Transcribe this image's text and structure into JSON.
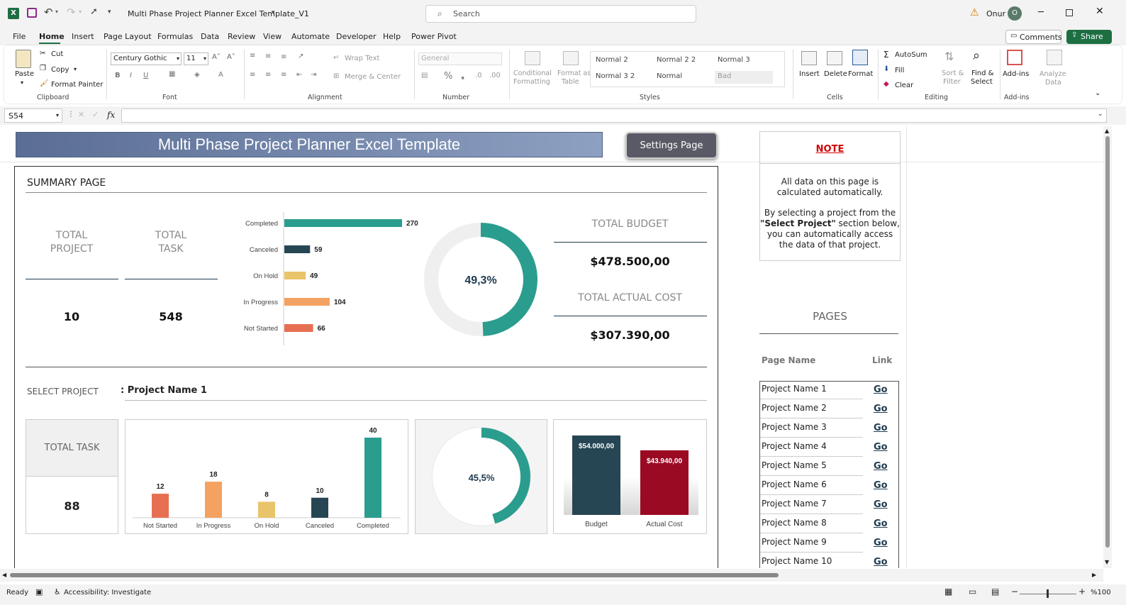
{
  "titlebar": {
    "doc_title": "Multi Phase Project Planner Excel Template_V1",
    "search_placeholder": "Search",
    "user_name": "Onur",
    "user_initial": "O"
  },
  "menu": [
    "File",
    "Home",
    "Insert",
    "Page Layout",
    "Formulas",
    "Data",
    "Review",
    "View",
    "Automate",
    "Developer",
    "Help",
    "Power Pivot"
  ],
  "topbuttons": {
    "comments": "Comments",
    "share": "Share"
  },
  "ribbon": {
    "clipboard": {
      "paste": "Paste",
      "cut": "Cut",
      "copy": "Copy",
      "format_painter": "Format Painter",
      "label": "Clipboard"
    },
    "font": {
      "name": "Century Gothic",
      "size": "11",
      "label": "Font"
    },
    "alignment": {
      "wrap": "Wrap Text",
      "merge": "Merge & Center",
      "label": "Alignment"
    },
    "number": {
      "format": "General",
      "label": "Number"
    },
    "styles": {
      "cond": "Conditional",
      "cond2": "Formatting",
      "fmt_table": "Format as",
      "fmt_table2": "Table",
      "label": "Styles",
      "cells": [
        "Normal 2",
        "Normal 2 2",
        "Normal 3",
        "Normal 3 2",
        "Normal",
        "Bad"
      ]
    },
    "cells": {
      "insert": "Insert",
      "delete": "Delete",
      "format": "Format",
      "label": "Cells"
    },
    "editing": {
      "autosum": "AutoSum",
      "fill": "Fill",
      "clear": "Clear",
      "sort": "Sort &",
      "sort2": "Filter",
      "find": "Find &",
      "find2": "Select",
      "label": "Editing"
    },
    "addins": {
      "addins": "Add-ins",
      "analyze": "Analyze",
      "analyze2": "Data",
      "label": "Add-ins"
    }
  },
  "formula": {
    "namebox": "S54",
    "fx": "fx"
  },
  "dashboard": {
    "title": "Multi Phase Project Planner Excel Template",
    "settings": "Settings Page",
    "summary": "SUMMARY PAGE",
    "total_project_label": [
      "TOTAL",
      "PROJECT"
    ],
    "total_task_label": [
      "TOTAL",
      "TASK"
    ],
    "total_project_value": "10",
    "total_task_value": "548",
    "total_budget_label": "TOTAL BUDGET",
    "total_budget_value": "$478.500,00",
    "total_actual_label": "TOTAL ACTUAL COST",
    "total_actual_value": "$307.390,00",
    "select_project_label": "SELECT PROJECT",
    "select_project_value": ": Project Name 1",
    "project_total_task_label": "TOTAL TASK",
    "project_total_task_value": "88"
  },
  "note": {
    "title": "NOTE",
    "line1": "All data on this page is",
    "line2": "calculated automatically.",
    "line3": "By selecting a project from the",
    "line4_bold": "\"Select Project\"",
    "line4_rest": " section below,",
    "line5": "you can automatically access",
    "line6": "the data of that project."
  },
  "pages": {
    "title": "PAGES",
    "col_name": "Page Name",
    "col_link": "Link",
    "link_text": "Go",
    "rows": [
      "Project Name 1",
      "Project Name 2",
      "Project Name 3",
      "Project Name 4",
      "Project Name 5",
      "Project Name 6",
      "Project Name 7",
      "Project Name 8",
      "Project Name 9",
      "Project Name 10"
    ]
  },
  "status": {
    "ready": "Ready",
    "accessibility": "Accessibility: Investigate",
    "zoom": "%100"
  },
  "colors": {
    "teal": "#2a9d8f",
    "navy": "#264653",
    "yellow": "#e9c46a",
    "orange": "#f4a261",
    "red": "#e76f51",
    "crimson": "#9b0a23"
  },
  "chart_data": [
    {
      "type": "bar",
      "orientation": "horizontal",
      "categories": [
        "Completed",
        "Canceled",
        "On Hold",
        "In Progress",
        "Not Started"
      ],
      "values": [
        270,
        59,
        49,
        104,
        66
      ],
      "colors": [
        "#2a9d8f",
        "#264653",
        "#e9c46a",
        "#f4a261",
        "#e76f51"
      ]
    },
    {
      "type": "pie",
      "variant": "donut",
      "values": [
        49.3,
        50.7
      ],
      "center_label": "49,3%"
    },
    {
      "type": "bar",
      "categories": [
        "Not Started",
        "In Progress",
        "On Hold",
        "Canceled",
        "Completed"
      ],
      "values": [
        12,
        18,
        8,
        10,
        40
      ],
      "colors": [
        "#e76f51",
        "#f4a261",
        "#e9c46a",
        "#264653",
        "#2a9d8f"
      ]
    },
    {
      "type": "pie",
      "variant": "donut",
      "values": [
        45.5,
        54.5
      ],
      "center_label": "45,5%"
    },
    {
      "type": "bar",
      "categories": [
        "Budget",
        "Actual Cost"
      ],
      "values": [
        54000,
        43940
      ],
      "labels": [
        "$54.000,00",
        "$43.940,00"
      ],
      "colors": [
        "#264653",
        "#9b0a23"
      ]
    }
  ]
}
